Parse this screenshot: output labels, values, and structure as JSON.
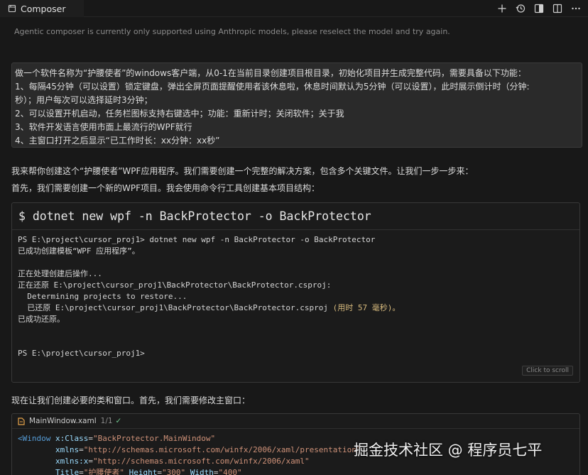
{
  "tab": {
    "label": "Composer",
    "icon": "composer-icon"
  },
  "toolbar": {
    "icons": [
      "plus-icon",
      "history-icon",
      "toggle-panel-icon",
      "split-view-icon",
      "more-icon"
    ]
  },
  "notice": "Agentic composer is currently only supported using Anthropic models, please reselect the model and try again.",
  "prompt": {
    "lines": [
      "做一个软件名称为“护腰使者”的windows客户端，从0-1在当前目录创建项目根目录，初始化项目并生成完整代码，需要具备以下功能：",
      "1、每隔45分钟（可以设置）锁定键盘，弹出全屏页面提醒使用者该休息啦，休息时间默认为5分钟（可以设置），此时展示倒计时（分钟:",
      "秒）；用户每次可以选择延时3分钟；",
      "2、可以设置开机启动，任务栏图标支持右键选中；功能：重新计时；关闭软件；关于我",
      "3、软件开发语言使用市面上最流行的WPF就行",
      "4、主窗口打开之后显示“已工作时长：xx分钟：xx秒”"
    ]
  },
  "answer": {
    "line1": "我来帮你创建这个“护腰使者”WPF应用程序。我们需要创建一个完整的解决方案，包含多个关键文件。让我们一步一步来：",
    "line2": "首先，我们需要创建一个新的WPF项目。我会使用命令行工具创建基本项目结构：",
    "line3": "现在让我们创建必要的类和窗口。首先，我们需要修改主窗口："
  },
  "terminal": {
    "command": "$ dotnet new wpf -n BackProtector -o BackProtector",
    "lines": {
      "l1": "PS E:\\project\\cursor_proj1> dotnet new wpf -n BackProtector -o BackProtector",
      "l2": "已成功创建模板“WPF 应用程序”。",
      "l3": "",
      "l4": "正在处理创建后操作...",
      "l5": "正在还原 E:\\project\\cursor_proj1\\BackProtector\\BackProtector.csproj:",
      "l6": "  Determining projects to restore...",
      "l7a": "  已还原 E:\\project\\cursor_proj1\\BackProtector\\BackProtector.csproj ",
      "l7b": "(用时 57 毫秒)。",
      "l8": "已成功还原。",
      "l9": "",
      "l10": "",
      "l11": "PS E:\\project\\cursor_proj1>"
    },
    "scroll_button": "Click to scroll"
  },
  "code": {
    "filename": "MainWindow.xaml",
    "page": "1/1",
    "check": "✓",
    "line1": {
      "open": "<",
      "tag": "Window",
      "attr": "x:Class",
      "eq": "=",
      "val": "\"BackProtector.MainWindow\""
    },
    "line2": {
      "indent": "        ",
      "attr": "xmlns",
      "eq": "=",
      "val": "\"http://schemas.microsoft.com/winfx/2006/xaml/presentation\""
    },
    "line3": {
      "indent": "        ",
      "attr": "xmlns:x",
      "eq": "=",
      "val": "\"http://schemas.microsoft.com/winfx/2006/xaml\""
    },
    "line4": {
      "indent": "        ",
      "attr": "Title",
      "eq": "=",
      "val": "\"护腰使者\"",
      "rest_attr": " Height",
      "rest_val": "\"300\"",
      "rest_attr2": " Width",
      "rest_val2": "\"400\""
    }
  },
  "watermark": "掘金技术社区 @ 程序员七平",
  "colors": {
    "background": "#181818",
    "panel": "#2a2a2a",
    "tag": "#569cd6",
    "attribute": "#9cdcfe",
    "string": "#ce9178"
  }
}
